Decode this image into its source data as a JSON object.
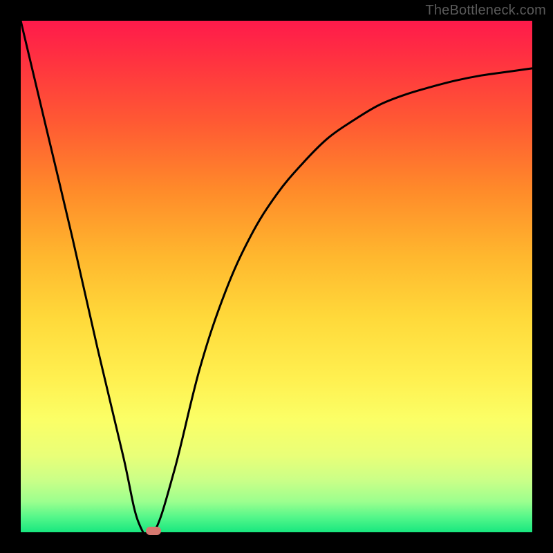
{
  "watermark": "TheBottleneck.com",
  "colors": {
    "background": "#000000",
    "curve": "#000000",
    "marker": "#d6786f"
  },
  "chart_data": {
    "type": "line",
    "title": "",
    "xlabel": "",
    "ylabel": "",
    "xlim": [
      0,
      100
    ],
    "ylim": [
      0,
      100
    ],
    "series": [
      {
        "name": "bottleneck-curve",
        "x": [
          0,
          5,
          10,
          15,
          20,
          23,
          26,
          30,
          35,
          40,
          45,
          50,
          55,
          60,
          65,
          70,
          75,
          80,
          85,
          90,
          95,
          100
        ],
        "values": [
          100,
          79,
          58,
          36,
          15,
          2,
          0,
          12,
          32,
          47,
          58,
          66,
          72,
          77,
          80.5,
          83.5,
          85.5,
          87,
          88.3,
          89.3,
          90,
          90.7
        ]
      }
    ],
    "marker": {
      "x": 26,
      "y": 0
    },
    "grid": false,
    "legend": false
  }
}
